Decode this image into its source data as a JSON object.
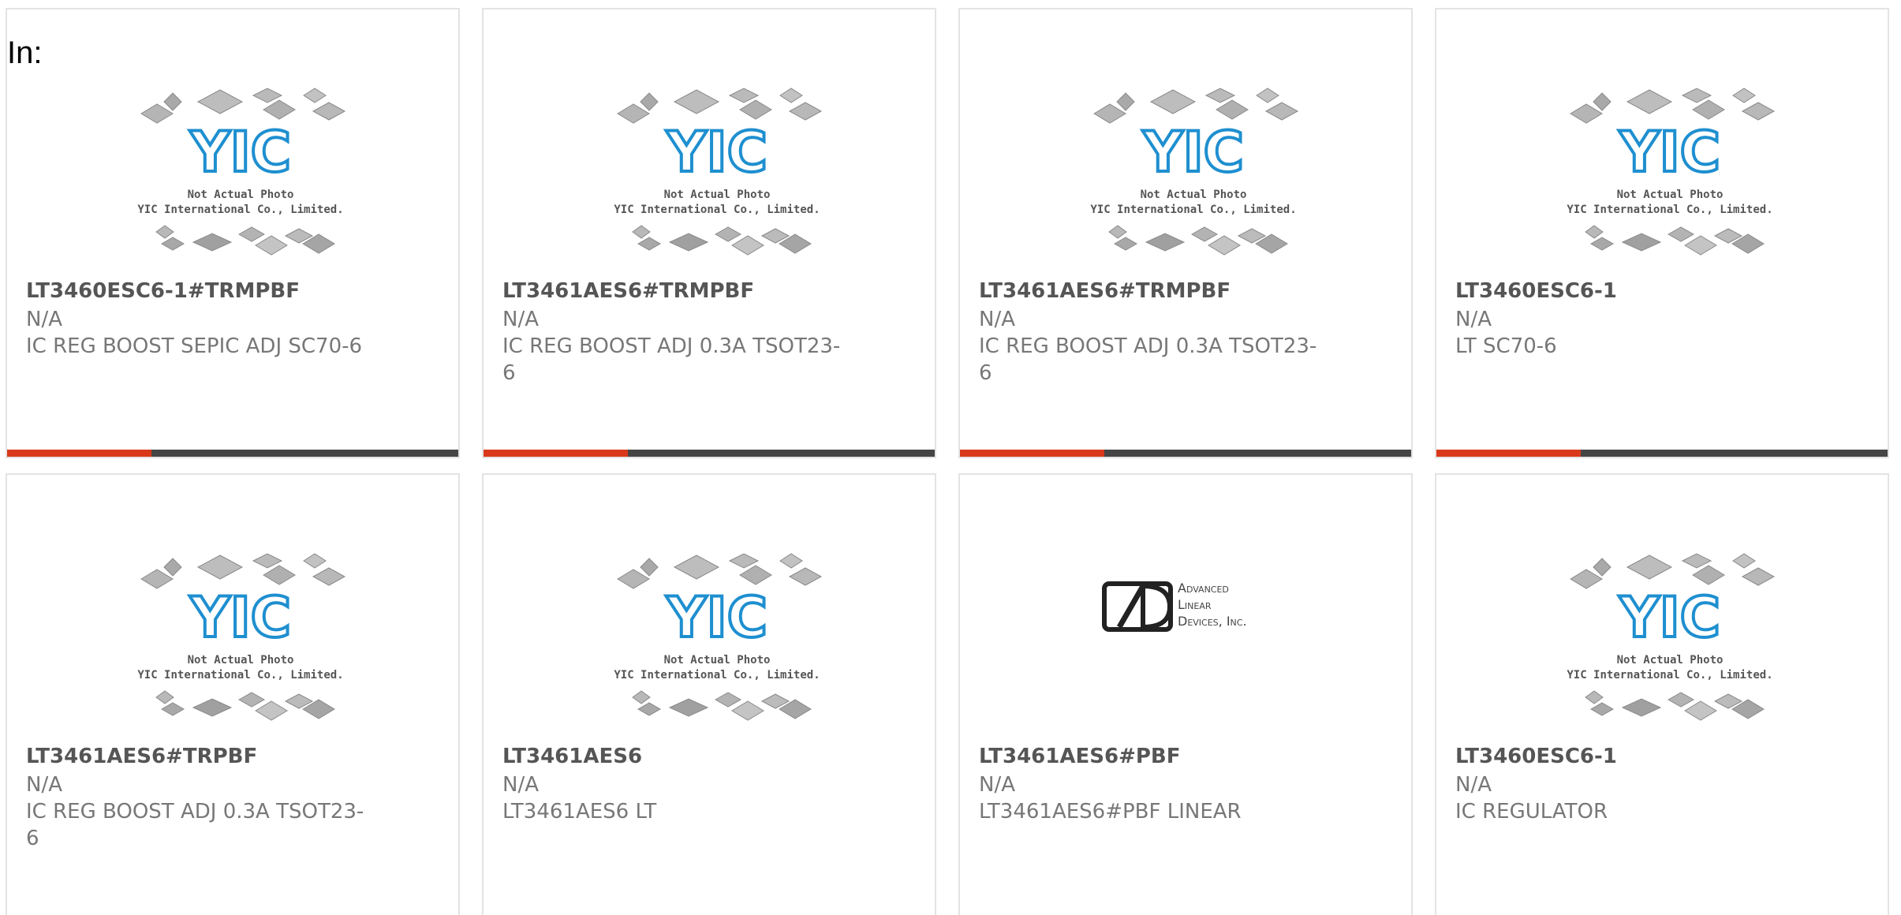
{
  "header": {
    "in_label": "In:"
  },
  "photo_placeholder": {
    "logo_text": "YIC",
    "caption_line1": "Not Actual Photo",
    "caption_line2": "YIC International Co., Limited."
  },
  "adl_logo": {
    "line1": "Advanced",
    "line2": "Linear",
    "line3": "Devices, Inc."
  },
  "colors": {
    "accent": "#d9391a",
    "bar": "#454545",
    "logo_blue": "#1e8fd0",
    "card_border": "#e3e3e3"
  },
  "products": [
    {
      "part_number": "LT3460ESC6-1#TRMPBF",
      "manufacturer": "N/A",
      "description": "IC REG BOOST SEPIC ADJ SC70-6",
      "image": "yic-not-actual-photo"
    },
    {
      "part_number": "LT3461AES6#TRMPBF",
      "manufacturer": "N/A",
      "description": "IC REG BOOST ADJ 0.3A TSOT23-6",
      "image": "yic-not-actual-photo"
    },
    {
      "part_number": "LT3461AES6#TRMPBF",
      "manufacturer": "N/A",
      "description": "IC REG BOOST ADJ 0.3A TSOT23-6",
      "image": "yic-not-actual-photo"
    },
    {
      "part_number": "LT3460ESC6-1",
      "manufacturer": "N/A",
      "description": "LT SC70-6",
      "image": "yic-not-actual-photo"
    },
    {
      "part_number": "LT3461AES6#TRPBF",
      "manufacturer": "N/A",
      "description": "IC REG BOOST ADJ 0.3A TSOT23-6",
      "image": "yic-not-actual-photo"
    },
    {
      "part_number": "LT3461AES6",
      "manufacturer": "N/A",
      "description": "LT3461AES6 LT",
      "image": "yic-not-actual-photo"
    },
    {
      "part_number": "LT3461AES6#PBF",
      "manufacturer": "N/A",
      "description": "LT3461AES6#PBF LINEAR",
      "image": "adl-logo"
    },
    {
      "part_number": "LT3460ESC6-1",
      "manufacturer": "N/A",
      "description": "IC REGULATOR",
      "image": "yic-not-actual-photo"
    }
  ]
}
